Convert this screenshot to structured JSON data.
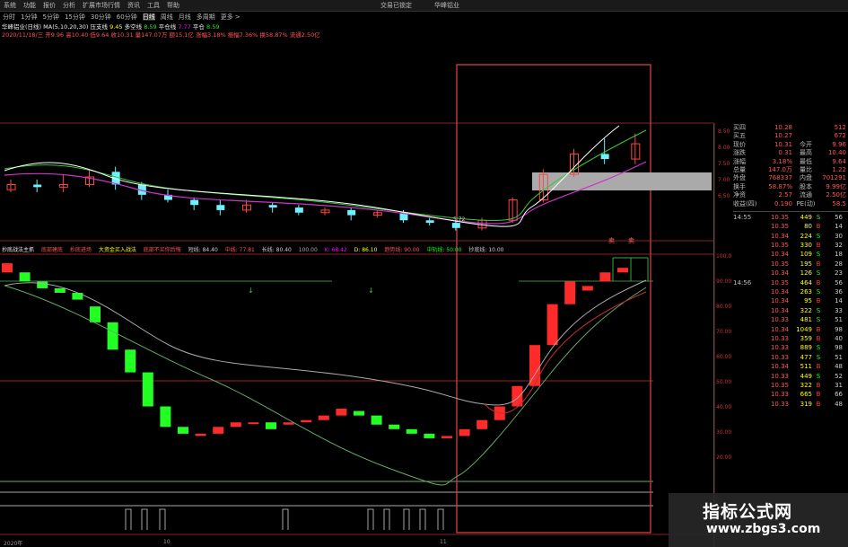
{
  "menu": {
    "items": [
      "系统",
      "功能",
      "报价",
      "分析",
      "扩展市场行情",
      "资讯",
      "工具",
      "帮助"
    ],
    "right": [
      "交易已锁定",
      "华峰铝业"
    ]
  },
  "periods": {
    "items": [
      "分时",
      "1分钟",
      "5分钟",
      "15分钟",
      "30分钟",
      "60分钟",
      "日线",
      "周线",
      "月线",
      "多周期",
      "更多 >"
    ],
    "active": "日线"
  },
  "stock": {
    "line1": {
      "name": "华峰铝业(日线)",
      "ma_label": "MA(5,10,20,30) 压支线",
      "v1": "9.45",
      "v2_label": "多空线",
      "v2": "8.59",
      "v3_label": "平仓线",
      "v3": "7.77",
      "v4_label": "平仓",
      "v4": "8.59"
    },
    "line2": "2020/11/18/三 开9.96 高10.40 低9.64 收10.31 量147.07万 额15.1亿 涨幅3.18% 振幅7.36% 换58.87% 流通2.50亿"
  },
  "indicator": {
    "name": "抄底战法主抓",
    "items": [
      "底部建底",
      "抄底进场",
      "大资金买入战法",
      "底部不买你后悔",
      "短线: 84.40",
      "中线: 77.81",
      "长线: 80.40",
      "100.00",
      "K: 68.42",
      "D: 86.10",
      "趋势线: 90.00",
      "中轨线: 50.00",
      "抄底线: 10.00"
    ],
    "markers": [
      "卖",
      "卖"
    ]
  },
  "quote": {
    "rows": [
      {
        "label": "买四",
        "v1": "10.28",
        "label2": "",
        "v2": "512"
      },
      {
        "label": "买五",
        "v1": "10.27",
        "label2": "",
        "v2": "672"
      },
      {
        "label": "现价",
        "v1": "10.31",
        "label2": "今开",
        "v2": "9.96"
      },
      {
        "label": "涨跌",
        "v1": "0.31",
        "label2": "最高",
        "v2": "10.40"
      },
      {
        "label": "涨幅",
        "v1": "3.18%",
        "label2": "最低",
        "v2": "9.64"
      },
      {
        "label": "总量",
        "v1": "147.0万",
        "label2": "量比",
        "v2": "1.22"
      },
      {
        "label": "外盘",
        "v1": "768337",
        "label2": "内盘",
        "v2": "701291"
      },
      {
        "label": "换手",
        "v1": "58.87%",
        "label2": "股本",
        "v2": "9.99亿"
      },
      {
        "label": "净资",
        "v1": "2.57",
        "label2": "流通",
        "v2": "2.50亿"
      },
      {
        "label": "收益(四)",
        "v1": "0.190",
        "label2": "PE(动)",
        "v2": "58.5"
      }
    ]
  },
  "ticks": [
    {
      "time": "14:55",
      "price": "10.35",
      "vol": "449",
      "bs": "S",
      "n": "56"
    },
    {
      "time": "",
      "price": "10.35",
      "vol": "80",
      "bs": "B",
      "n": "14"
    },
    {
      "time": "",
      "price": "10.34",
      "vol": "224",
      "bs": "S",
      "n": "30"
    },
    {
      "time": "",
      "price": "10.35",
      "vol": "330",
      "bs": "B",
      "n": "32"
    },
    {
      "time": "",
      "price": "10.34",
      "vol": "109",
      "bs": "S",
      "n": "18"
    },
    {
      "time": "",
      "price": "10.35",
      "vol": "195",
      "bs": "B",
      "n": "28"
    },
    {
      "time": "",
      "price": "10.34",
      "vol": "126",
      "bs": "S",
      "n": "23"
    },
    {
      "time": "14:56",
      "price": "10.35",
      "vol": "464",
      "bs": "B",
      "n": "56"
    },
    {
      "time": "",
      "price": "10.34",
      "vol": "263",
      "bs": "S",
      "n": "36"
    },
    {
      "time": "",
      "price": "10.34",
      "vol": "95",
      "bs": "B",
      "n": "14"
    },
    {
      "time": "",
      "price": "10.34",
      "vol": "322",
      "bs": "S",
      "n": "33"
    },
    {
      "time": "",
      "price": "10.33",
      "vol": "481",
      "bs": "S",
      "n": "51"
    },
    {
      "time": "",
      "price": "10.34",
      "vol": "1049",
      "bs": "B",
      "n": "98"
    },
    {
      "time": "",
      "price": "10.33",
      "vol": "359",
      "bs": "B",
      "n": "40"
    },
    {
      "time": "",
      "price": "10.33",
      "vol": "889",
      "bs": "S",
      "n": "98"
    },
    {
      "time": "",
      "price": "10.33",
      "vol": "477",
      "bs": "S",
      "n": "51"
    },
    {
      "time": "",
      "price": "10.34",
      "vol": "511",
      "bs": "B",
      "n": "48"
    },
    {
      "time": "",
      "price": "10.33",
      "vol": "449",
      "bs": "S",
      "n": "52"
    },
    {
      "time": "",
      "price": "10.35",
      "vol": "322",
      "bs": "B",
      "n": "31"
    },
    {
      "time": "",
      "price": "10.33",
      "vol": "665",
      "bs": "B",
      "n": "66"
    },
    {
      "time": "",
      "price": "10.33",
      "vol": "319",
      "bs": "B",
      "n": "48"
    }
  ],
  "axis": {
    "upper": [
      "8.50",
      "8.00",
      "7.50",
      "7.00",
      "6.50"
    ],
    "lower": [
      "100.0",
      "90.00",
      "80.00",
      "70.00",
      "60.00",
      "50.00",
      "40.00",
      "30.00",
      "20.00"
    ],
    "x": [
      "2020年",
      "10",
      "11"
    ]
  },
  "price_tag": "5.72",
  "watermark": {
    "title": "指标公式网",
    "url": "www.zbgs3.com"
  },
  "colors": {
    "up": "#ff2a2a",
    "down": "#22ff22",
    "cyan": "#6cf3ff",
    "white": "#ffffff",
    "magenta": "#cc33cc",
    "green": "#33cc33"
  },
  "chart_data": {
    "type": "candlestick",
    "upper_candles": [
      [
        7.5,
        7.6,
        7.45,
        7.7,
        0
      ],
      [
        7.6,
        7.55,
        7.45,
        7.7,
        1
      ],
      [
        7.55,
        7.6,
        7.45,
        7.8,
        0
      ],
      [
        7.6,
        7.75,
        7.55,
        7.9,
        0
      ],
      [
        7.85,
        7.6,
        7.5,
        7.95,
        1
      ],
      [
        7.6,
        7.4,
        7.3,
        7.65,
        1
      ],
      [
        7.4,
        7.3,
        7.25,
        7.5,
        1
      ],
      [
        7.3,
        7.2,
        7.1,
        7.35,
        1
      ],
      [
        7.2,
        7.1,
        7.0,
        7.3,
        1
      ],
      [
        7.1,
        7.2,
        7.05,
        7.3,
        0
      ],
      [
        7.2,
        7.15,
        7.05,
        7.25,
        1
      ],
      [
        7.15,
        7.05,
        7.0,
        7.2,
        1
      ],
      [
        7.05,
        7.1,
        7.0,
        7.15,
        0
      ],
      [
        7.1,
        7.0,
        6.9,
        7.15,
        1
      ],
      [
        7.0,
        7.05,
        6.95,
        7.1,
        0
      ],
      [
        7.05,
        6.9,
        6.85,
        7.1,
        1
      ],
      [
        6.9,
        6.85,
        6.8,
        6.95,
        1
      ],
      [
        6.85,
        6.75,
        6.7,
        6.9,
        1
      ],
      [
        6.75,
        6.9,
        6.7,
        6.95,
        0
      ],
      [
        6.9,
        7.3,
        6.85,
        7.35,
        0
      ],
      [
        7.3,
        7.8,
        7.25,
        7.9,
        0
      ],
      [
        7.8,
        8.2,
        7.75,
        8.3,
        0
      ],
      [
        8.2,
        8.1,
        8.0,
        8.5,
        1
      ],
      [
        8.1,
        8.4,
        8.0,
        8.6,
        0
      ]
    ],
    "lower_candles": [
      [
        96,
        92,
        0
      ],
      [
        92,
        88,
        1
      ],
      [
        88,
        85,
        1
      ],
      [
        85,
        83,
        1
      ],
      [
        83,
        80,
        1
      ],
      [
        77,
        70,
        1
      ],
      [
        70,
        58,
        1
      ],
      [
        58,
        48,
        1
      ],
      [
        48,
        33,
        1
      ],
      [
        33,
        24,
        1
      ],
      [
        24,
        21,
        1
      ],
      [
        21,
        20,
        0
      ],
      [
        21,
        24,
        0
      ],
      [
        24,
        26,
        0
      ],
      [
        26,
        26,
        0
      ],
      [
        26,
        23,
        1
      ],
      [
        25,
        26,
        0
      ],
      [
        26,
        27,
        0
      ],
      [
        27,
        29,
        0
      ],
      [
        29,
        32,
        0
      ],
      [
        31,
        29,
        1
      ],
      [
        29,
        25,
        1
      ],
      [
        25,
        23,
        1
      ],
      [
        23,
        21,
        1
      ],
      [
        21,
        19,
        1
      ],
      [
        19,
        20,
        0
      ],
      [
        20,
        23,
        0
      ],
      [
        23,
        27,
        0
      ],
      [
        27,
        33,
        0
      ],
      [
        33,
        42,
        0
      ],
      [
        42,
        60,
        0
      ],
      [
        60,
        78,
        0
      ],
      [
        78,
        88,
        0
      ],
      [
        84,
        86,
        0
      ],
      [
        88,
        92,
        0
      ],
      [
        92,
        94,
        0
      ]
    ]
  }
}
